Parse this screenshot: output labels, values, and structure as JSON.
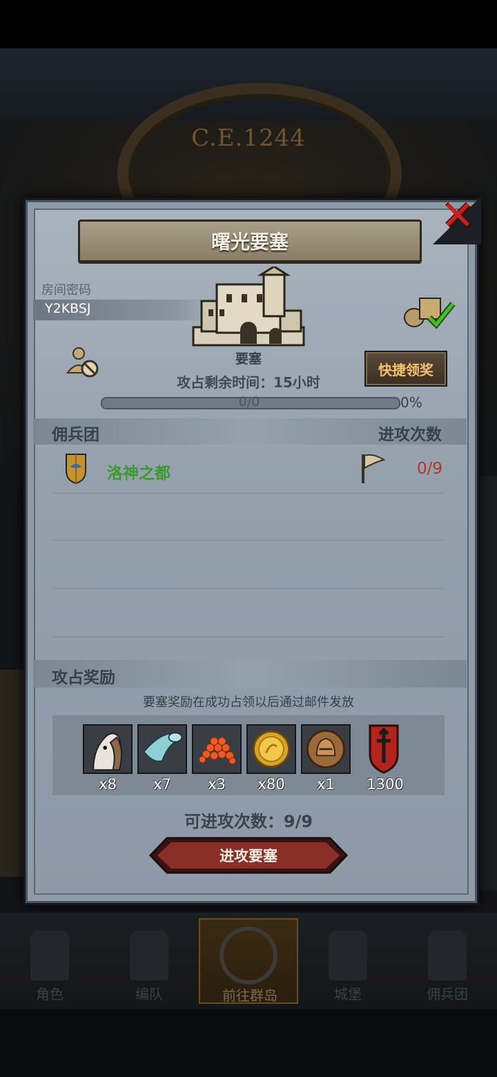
{
  "background": {
    "era_text": "C.E.1244"
  },
  "dialog": {
    "title": "曙光要塞",
    "room": {
      "label": "房间密码",
      "code": "Y2KBSJ"
    },
    "fort_label": "要塞",
    "quick_claim": "快捷领奖",
    "remaining_time": "攻占剩余时间：15小时",
    "progress": {
      "text": "0/0",
      "percent_text": "0%",
      "fraction": 0
    },
    "table": {
      "left_header": "佣兵团",
      "right_header": "进攻次数",
      "rows": [
        {
          "guild": "洛神之都",
          "attacks": "0/9"
        }
      ]
    },
    "rewards": {
      "title": "攻占奖励",
      "note": "要塞奖励在成功占领以后通过邮件发放",
      "items": [
        {
          "icon": "horse-icon",
          "qty": "x8"
        },
        {
          "icon": "cloth-icon",
          "qty": "x7"
        },
        {
          "icon": "caviar-icon",
          "qty": "x3"
        },
        {
          "icon": "gold-coin-icon",
          "qty": "x80"
        },
        {
          "icon": "helmet-medal-icon",
          "qty": "x1"
        },
        {
          "icon": "guild-banner-icon",
          "qty": "1300"
        }
      ]
    },
    "attacks_left": "可进攻次数：9/9",
    "attack_button": "进攻要塞"
  },
  "nav": {
    "items": [
      {
        "label": "角色",
        "icon": "knight-icon"
      },
      {
        "label": "编队",
        "icon": "helmet-icon"
      },
      {
        "label": "前往群岛",
        "icon": "compass-icon",
        "active": true
      },
      {
        "label": "城堡",
        "icon": "castle-icon"
      },
      {
        "label": "佣兵团",
        "icon": "warrior-icon"
      }
    ]
  },
  "colors": {
    "guild_name": "#3c9a2c",
    "attack_count": "#b8322c",
    "quick_claim_text": "#f5c26b",
    "close": "#c8221c"
  }
}
